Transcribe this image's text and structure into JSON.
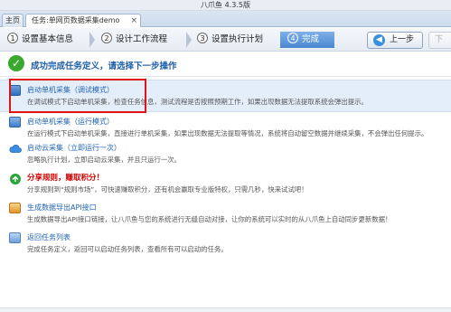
{
  "window": {
    "title": "八爪鱼 4.3.5版"
  },
  "tabs": [
    {
      "label": "主页"
    },
    {
      "label": "任务:单网页数据采集demo",
      "close": "×"
    }
  ],
  "steps": [
    {
      "num": "1",
      "label": "设置基本信息"
    },
    {
      "num": "2",
      "label": "设计工作流程"
    },
    {
      "num": "3",
      "label": "设置执行计划"
    },
    {
      "num": "4",
      "label": "完成"
    }
  ],
  "nav": {
    "prev_label": "上一步",
    "prev_arrow": "◀",
    "next_label": "下"
  },
  "success": {
    "message": "成功完成任务定义，请选择下一步操作",
    "check": "✓"
  },
  "options": [
    {
      "icon": "debug-run-icon",
      "title": "启动单机采集（调试模式）",
      "desc": "在调试模式下启动单机采集，检查任务信息，测试流程是否按照预期工作，如果出现数据无法提取系统会弹出提示。"
    },
    {
      "icon": "local-run-icon",
      "title": "启动单机采集（运行模式）",
      "desc": "在运行模式下启动单机采集，直接进行单机采集，如果出现数据无法提取等情况，系统将自动留空数据并继续采集，不会弹出任何提示。"
    },
    {
      "icon": "cloud-icon",
      "title": "启动云采集（立即运行一次）",
      "desc": "忽略执行计划，立即启动云采集，并且只运行一次。"
    },
    {
      "icon": "share-icon",
      "title": "分享规则，赚取积分！",
      "desc": "分享规则到“规则市场”，可快速赚取积分，还有机会赢取专业版特权，只需几秒，快来试试吧！"
    },
    {
      "icon": "api-icon",
      "title": "生成数据导出API接口",
      "desc": "生成数据导出API接口链接，让八爪鱼与您的系统进行无缝自动对接，让你的系统可以实时的从八爪鱼上自动同步更新数据！"
    },
    {
      "icon": "list-icon",
      "title": "返回任务列表",
      "desc": "完成任务定义，返回可以启动任务列表，查看所有可以启动的任务。"
    }
  ],
  "colors": {
    "accent": "#4a87d2",
    "success": "#3aa82f",
    "highlight": "#e01414",
    "share_title": "#d40000"
  }
}
